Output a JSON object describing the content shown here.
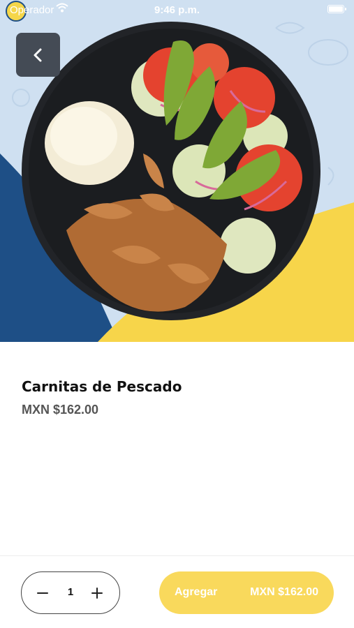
{
  "status_bar": {
    "carrier": "Operador",
    "time": "9:46 p.m."
  },
  "product": {
    "name": "Carnitas de Pescado",
    "price": "MXN $162.00"
  },
  "cart": {
    "quantity": "1",
    "add_label": "Agregar",
    "add_amount": "MXN $162.00"
  },
  "icons": {
    "back": "chevron-left-icon",
    "minus": "minus-icon",
    "plus": "plus-icon",
    "wifi": "wifi-icon",
    "battery": "battery-icon"
  },
  "colors": {
    "accent_yellow": "#f9d95c",
    "brand_blue": "#1e4f86",
    "back_button": "#444b55"
  }
}
